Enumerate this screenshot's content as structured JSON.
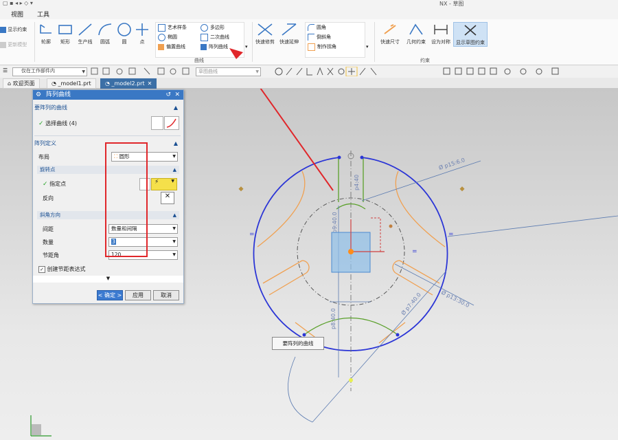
{
  "titlebar": {
    "app_title": "NX - 草图"
  },
  "menu": {
    "items": [
      "视图",
      "工具"
    ]
  },
  "ribbon": {
    "left_buttons": [
      "显示约束",
      "更新模型"
    ],
    "draw_buttons": [
      "轮廓",
      "矩形",
      "生产线",
      "圆弧",
      "圆",
      "点"
    ],
    "curve_list_col1": [
      "艺术样条",
      "椭圆",
      "偏置曲线"
    ],
    "curve_list_col2": [
      "多边形",
      "二次曲线",
      "阵列曲线"
    ],
    "curve_group_label": "曲线",
    "edit_buttons": [
      "快速修剪",
      "快速延伸"
    ],
    "edit_list": [
      "圆角",
      "倒斜角",
      "制作拐角"
    ],
    "constraint_buttons": [
      "快速尺寸",
      "几何约束",
      "设为对称",
      "显示草图约束"
    ],
    "constraint_group_label": "约束"
  },
  "toolbar2": {
    "scope_combo": "仅在工作部件内",
    "filter_combo": "草图曲线"
  },
  "tabs": [
    {
      "label": "欢迎页面",
      "active": false
    },
    {
      "label": "_model1.prt",
      "active": false
    },
    {
      "label": "_model2.prt",
      "active": true
    }
  ],
  "dialog": {
    "title": "阵列曲线",
    "section_curves": "要阵列的曲线",
    "select_curve_label": "选择曲线 (4)",
    "section_definition": "阵列定义",
    "layout_label": "布局",
    "layout_value": "圆形",
    "rotation_point_head": "旋转点",
    "specify_point_label": "指定点",
    "reverse_label": "反向",
    "angle_direction_head": "斜角方向",
    "spacing_label": "间距",
    "spacing_value": "数量和间隔",
    "count_label": "数量",
    "count_value": "3",
    "pitch_label": "节距角",
    "pitch_value": "120",
    "create_expr_label": "创建节距表达式",
    "create_expr_checked": true,
    "ok_button": "< 确定 >",
    "apply_button": "应用",
    "cancel_button": "取消"
  },
  "sketch": {
    "dim_labels": [
      "Ø p15:6.0",
      "Ø p13:30.0",
      "Ø p7:40.0",
      "p8:40.0",
      "p9:40.0",
      "p4:40"
    ],
    "callout": "要阵列的曲线"
  },
  "colors": {
    "accent": "#3a78c4",
    "highlight_box": "#e0262a",
    "sketch_blue": "#2b35d6",
    "sketch_orange": "#f0a050",
    "sketch_green": "#5aa02a"
  }
}
